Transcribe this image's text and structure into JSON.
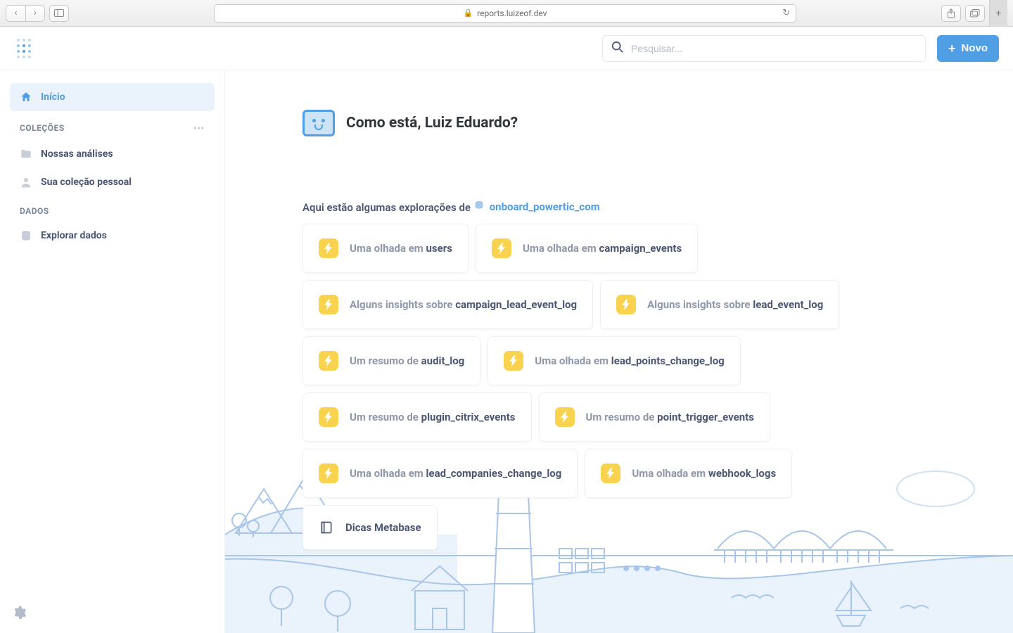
{
  "browser": {
    "url": "reports.luizeof.dev"
  },
  "header": {
    "search_placeholder": "Pesquisar...",
    "new_button": "Novo"
  },
  "sidebar": {
    "home": "Início",
    "collections_header": "COLEÇÕES",
    "our_analytics": "Nossas análises",
    "personal_collection": "Sua coleção pessoal",
    "data_header": "DADOS",
    "explore_data": "Explorar dados"
  },
  "main": {
    "greeting": "Como está, Luiz Eduardo?",
    "explore_prefix": "Aqui estão algumas explorações de",
    "database_name": "onboard_powertic_com",
    "cards": [
      {
        "prefix": "Uma olhada em ",
        "subject": "users"
      },
      {
        "prefix": "Uma olhada em ",
        "subject": "campaign_events"
      },
      {
        "prefix": "Alguns insights sobre ",
        "subject": "campaign_lead_event_log"
      },
      {
        "prefix": "Alguns insights sobre ",
        "subject": "lead_event_log"
      },
      {
        "prefix": "Um resumo de ",
        "subject": "audit_log"
      },
      {
        "prefix": "Uma olhada em ",
        "subject": "lead_points_change_log"
      },
      {
        "prefix": "Um resumo de ",
        "subject": "plugin_citrix_events"
      },
      {
        "prefix": "Um resumo de ",
        "subject": "point_trigger_events"
      },
      {
        "prefix": "Uma olhada em ",
        "subject": "lead_companies_change_log"
      },
      {
        "prefix": "Uma olhada em ",
        "subject": "webhook_logs"
      }
    ],
    "tips_label": "Dicas Metabase"
  }
}
